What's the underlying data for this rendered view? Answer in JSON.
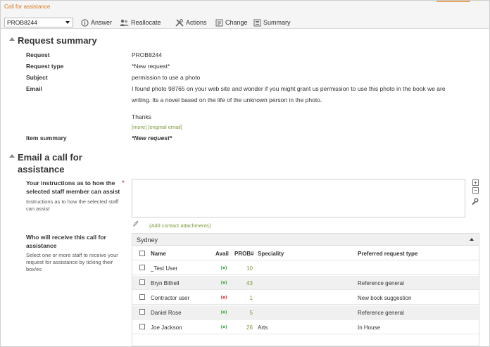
{
  "window": {
    "title": "Call for assistance"
  },
  "toolbar": {
    "select_value": "PROB8244",
    "answer": "Answer",
    "reallocate": "Reallocate",
    "actions": "Actions",
    "change": "Change",
    "summary": "Summary"
  },
  "request_summary": {
    "title": "Request summary",
    "rows": [
      {
        "label": "Request",
        "value": "PROB8244"
      },
      {
        "label": "Request type",
        "value": "*New request*"
      },
      {
        "label": "Subject",
        "value": "permission to use a photo"
      },
      {
        "label": "Email",
        "value": "I found photo 98765 on your web site and wonder if you might grant us permission to use this photo in the book we are"
      }
    ],
    "email_line2": "writing.  Its a novel based on the life of the unknown person in the photo.",
    "email_thanks": "Thanks",
    "more_link": "[more]",
    "original_link": "[original email]",
    "item_summary_label": "Item summary",
    "item_summary_value": "*New request*"
  },
  "email_call": {
    "title_line1": "Email a call for",
    "title_line2": "assistance",
    "instructions_label_1": "Your instructions as to how the",
    "instructions_label_2": "selected staff member can assist",
    "instructions_hint_1": "Instructions as to how the selected staff",
    "instructions_hint_2": "can assist",
    "add_attachments": "(Add contact attachments)",
    "who_label_1": "Who will receive this call for",
    "who_label_2": "assistance",
    "who_hint_1": "Select one or more staff to receive your",
    "who_hint_2": "request for assistance by ticking their",
    "who_hint_3": "box/es"
  },
  "staff": {
    "group": "Sydney",
    "columns": {
      "name": "Name",
      "avail": "Avail",
      "prob": "PROB#",
      "speciality": "Speciality",
      "preferred": "Preferred request type"
    },
    "rows": [
      {
        "name": "_Test User",
        "avail": "green",
        "prob": "10",
        "speciality": "",
        "preferred": ""
      },
      {
        "name": "Bryn Bithell",
        "avail": "green",
        "prob": "43",
        "speciality": "",
        "preferred": "Reference general"
      },
      {
        "name": "Contractor user",
        "avail": "red",
        "prob": "1",
        "speciality": "",
        "preferred": "New book suggestion"
      },
      {
        "name": "Daniel Rose",
        "avail": "green",
        "prob": "5",
        "speciality": "",
        "preferred": "Reference general"
      },
      {
        "name": "Joe Jackson",
        "avail": "green",
        "prob": "26",
        "speciality": "Arts",
        "preferred": "In House"
      }
    ]
  },
  "colors": {
    "accent": "#e07b24",
    "link": "#7a9a3b",
    "avail_green": "#4caf50",
    "avail_red": "#e53935"
  }
}
